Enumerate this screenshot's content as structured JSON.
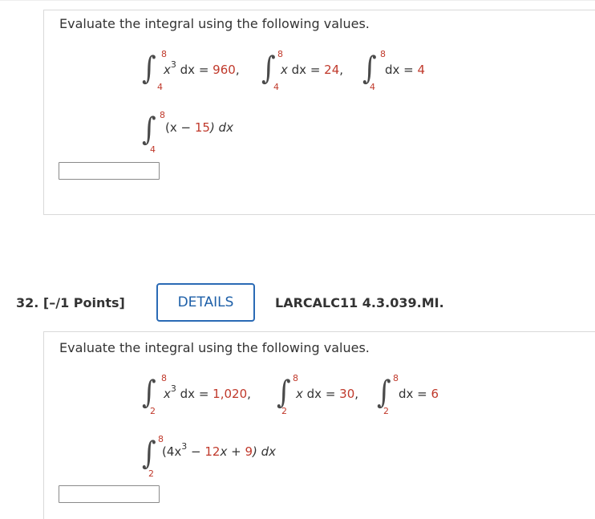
{
  "q31": {
    "prompt": "Evaluate the integral using the following values.",
    "given": [
      {
        "upper": "8",
        "lower": "4",
        "integrand": "x",
        "power": "3",
        "tail": " dx = ",
        "value": "960",
        "sep": ","
      },
      {
        "upper": "8",
        "lower": "4",
        "integrand": "x",
        "power": "",
        "tail": " dx = ",
        "value": "24",
        "sep": ","
      },
      {
        "upper": "8",
        "lower": "4",
        "integrand": "",
        "power": "",
        "tail": "dx = ",
        "value": "4",
        "sep": ""
      }
    ],
    "target": {
      "upper": "8",
      "lower": "4",
      "open": "(x − ",
      "num": "15",
      "close": ") dx"
    }
  },
  "q32": {
    "number": "32.",
    "points": "[–/1 Points]",
    "details_label": "DETAILS",
    "code": "LARCALC11 4.3.039.MI.",
    "prompt": "Evaluate the integral using the following values.",
    "given": [
      {
        "upper": "8",
        "lower": "2",
        "integrand": "x",
        "power": "3",
        "tail": " dx = ",
        "value": "1,020",
        "sep": ","
      },
      {
        "upper": "8",
        "lower": "2",
        "integrand": "x",
        "power": "",
        "tail": " dx = ",
        "value": "30",
        "sep": ","
      },
      {
        "upper": "8",
        "lower": "2",
        "integrand": "",
        "power": "",
        "tail": "dx = ",
        "value": "6",
        "sep": ""
      }
    ],
    "target": {
      "upper": "8",
      "lower": "2",
      "open": "(4x",
      "pow": "3",
      "mid": " − ",
      "c1": "12",
      "x": "x",
      "plus": " + ",
      "c2": "9",
      "close": ") dx"
    }
  },
  "colors": {
    "accent": "#2a6ab5",
    "limit": "#c0392b",
    "border": "#d9d9d9"
  }
}
